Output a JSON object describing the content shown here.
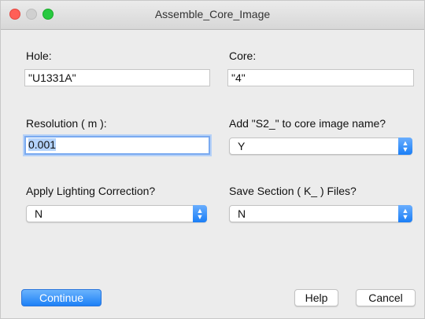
{
  "window": {
    "title": "Assemble_Core_Image"
  },
  "form": {
    "hole": {
      "label": "Hole:",
      "value": "\"U1331A\""
    },
    "core": {
      "label": "Core:",
      "value": "\"4\""
    },
    "resolution": {
      "label": "Resolution ( m ):",
      "value": "0.001"
    },
    "add_s2": {
      "label": "Add \"S2_\" to core image name?",
      "selected": "Y"
    },
    "lighting": {
      "label": "Apply Lighting Correction?",
      "selected": "N"
    },
    "save_section": {
      "label": "Save Section ( K_ ) Files?",
      "selected": "N"
    }
  },
  "buttons": {
    "continue": "Continue",
    "help": "Help",
    "cancel": "Cancel"
  },
  "icons": {
    "close": "close-traffic-light",
    "minimize": "minimize-traffic-light",
    "maximize": "maximize-traffic-light",
    "select_arrows": "up-down-chevron-icon"
  },
  "colors": {
    "accent": "#1d80f6",
    "close": "#ff5f57",
    "maximize": "#28c940",
    "focus_ring": "#7aaaf0"
  }
}
